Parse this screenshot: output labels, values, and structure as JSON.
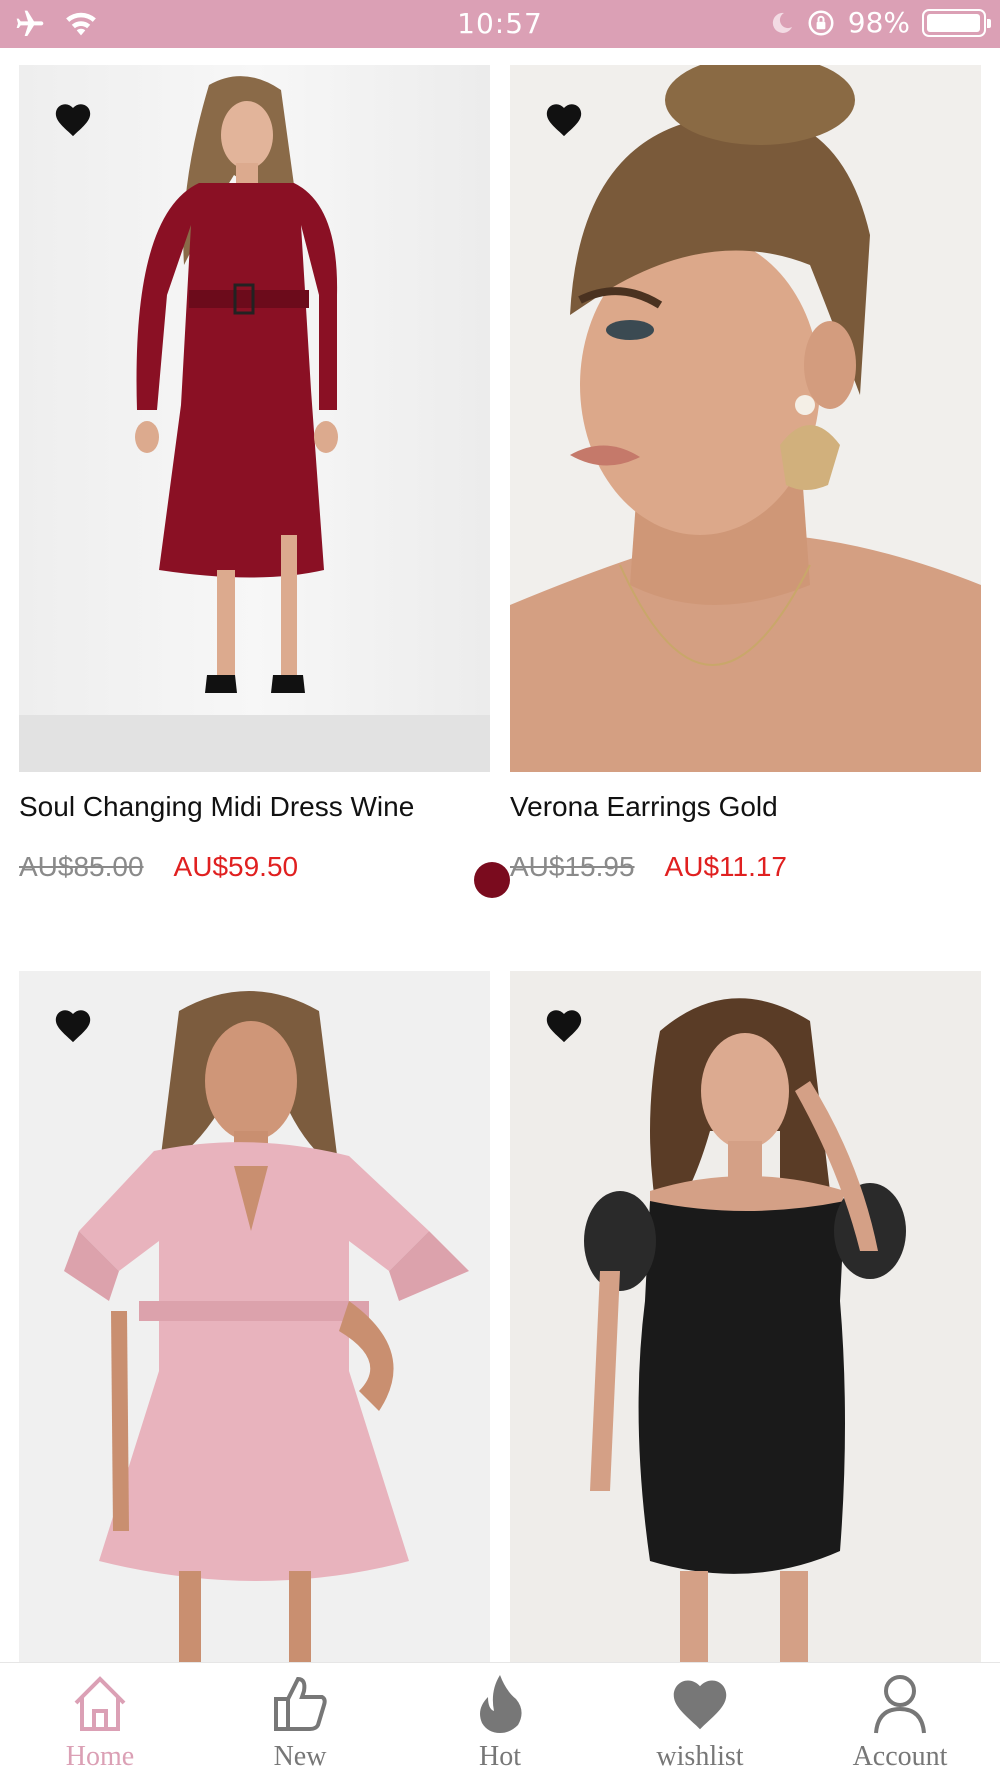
{
  "status_bar": {
    "time": "10:57",
    "battery": "98%",
    "battery_fraction": 0.98,
    "icons": [
      "airplane-icon",
      "wifi-icon",
      "moon-icon",
      "rotation-lock-icon",
      "battery-icon"
    ]
  },
  "products": [
    {
      "name": "Soul Changing Midi Dress Wine",
      "old_price": "AU$85.00",
      "new_price": "AU$59.50",
      "swatch_color": "#7a0b1e"
    },
    {
      "name": "Verona Earrings Gold",
      "old_price": "AU$15.95",
      "new_price": "AU$11.17"
    },
    {
      "name": "",
      "old_price": "",
      "new_price": ""
    },
    {
      "name": "",
      "old_price": "",
      "new_price": ""
    }
  ],
  "tabbar": {
    "items": [
      {
        "label": "Home",
        "icon": "home-icon",
        "active": true
      },
      {
        "label": "New",
        "icon": "thumbs-up-icon",
        "active": false
      },
      {
        "label": "Hot",
        "icon": "flame-icon",
        "active": false
      },
      {
        "label": "wishlist",
        "icon": "heart-icon",
        "active": false
      },
      {
        "label": "Account",
        "icon": "user-icon",
        "active": false
      }
    ]
  },
  "colors": {
    "brand_pink": "#dba0b5",
    "sale_red": "#e02020",
    "strikethrough_gray": "#8a8a8a"
  }
}
